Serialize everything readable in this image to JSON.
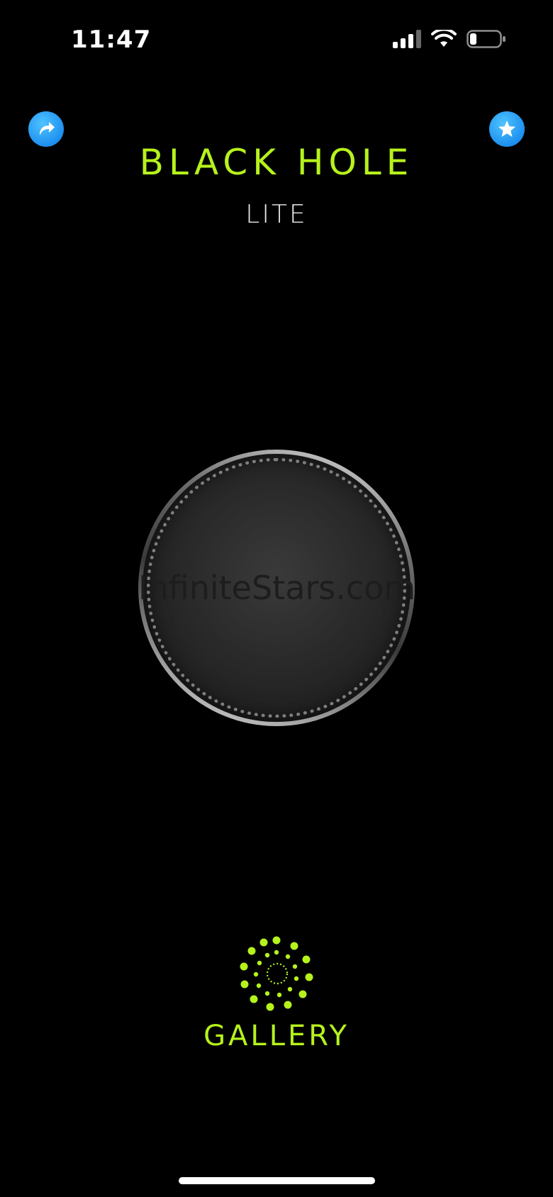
{
  "status_bar": {
    "time": "11:47",
    "signal_icon": "cellular-signal-icon",
    "wifi_icon": "wifi-icon",
    "battery_icon": "battery-icon",
    "battery_level": 0.2
  },
  "header": {
    "share_icon": "share-arrow-icon",
    "favorite_icon": "star-icon",
    "title": "BLACK HOLE",
    "subtitle": "LITE"
  },
  "center": {
    "watermark": "InfiniteStars.com"
  },
  "gallery": {
    "icon": "gallery-dots-icon",
    "label": "GALLERY"
  },
  "colors": {
    "accent": "#b6f21c",
    "button_blue": "#1e90f0",
    "background": "#000000"
  }
}
